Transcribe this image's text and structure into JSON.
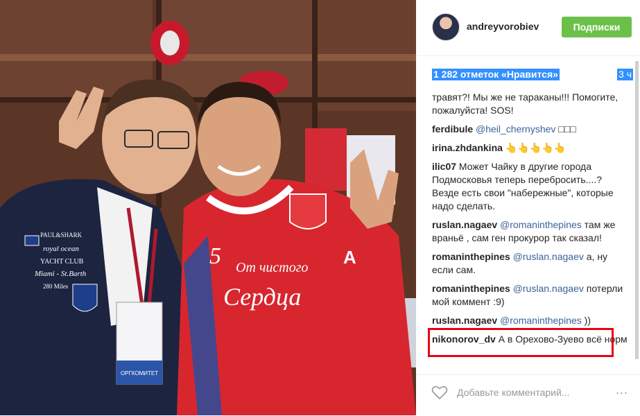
{
  "post": {
    "username": "andreyvorobiev",
    "follow_label": "Подписки",
    "likes": "1 282 отметок «Нравится»",
    "time": "3 ч"
  },
  "comments": [
    {
      "user": "",
      "mention": "",
      "text": "травят?! Мы же не тараканы!!! Помогите, пожалуйста! SOS!"
    },
    {
      "user": "ferdibule",
      "mention": "@heil_chernyshev",
      "text": "□□□"
    },
    {
      "user": "irina.zhdankina",
      "mention": "",
      "text": "👆👆👆👆👆"
    },
    {
      "user": "ilic07",
      "mention": "",
      "text": "Может Чайку в другие города Подмосковья теперь перебросить....? Везде есть свои \"набережные\", которые надо сделать."
    },
    {
      "user": "ruslan.nagaev",
      "mention": "@romaninthepines",
      "text": "там же враньё , сам ген прокурор так сказал!"
    },
    {
      "user": "romaninthepines",
      "mention": "@ruslan.nagaev",
      "text": "а, ну если сам."
    },
    {
      "user": "romaninthepines",
      "mention": "@ruslan.nagaev",
      "text": "потерли мой коммент :9)"
    },
    {
      "user": "ruslan.nagaev",
      "mention": "@romaninthepines",
      "text": "))"
    },
    {
      "user": "nikonorov_dv",
      "mention": "",
      "text": "А в Орехово-Зуево всё норм"
    }
  ],
  "footer": {
    "comment_placeholder": "Добавьте комментарий...",
    "more_label": "..."
  },
  "photo": {
    "jersey_text_1": "От чистого",
    "jersey_text_2": "Сердца",
    "jersey_letter": "А",
    "badge_text": "ОРГКОМИТЕТ",
    "jacket_brand": "PAUL&SHARK",
    "jacket_line1": "royal ocean",
    "jacket_line2": "YACHT CLUB",
    "jacket_line3": "Miami - St.Barth",
    "jacket_line4": "280 Miles"
  },
  "colors": {
    "follow_green": "#6cc04a",
    "selection_blue": "#3390ff",
    "highlight_red": "#e30613",
    "mention_blue": "#3d6199"
  }
}
